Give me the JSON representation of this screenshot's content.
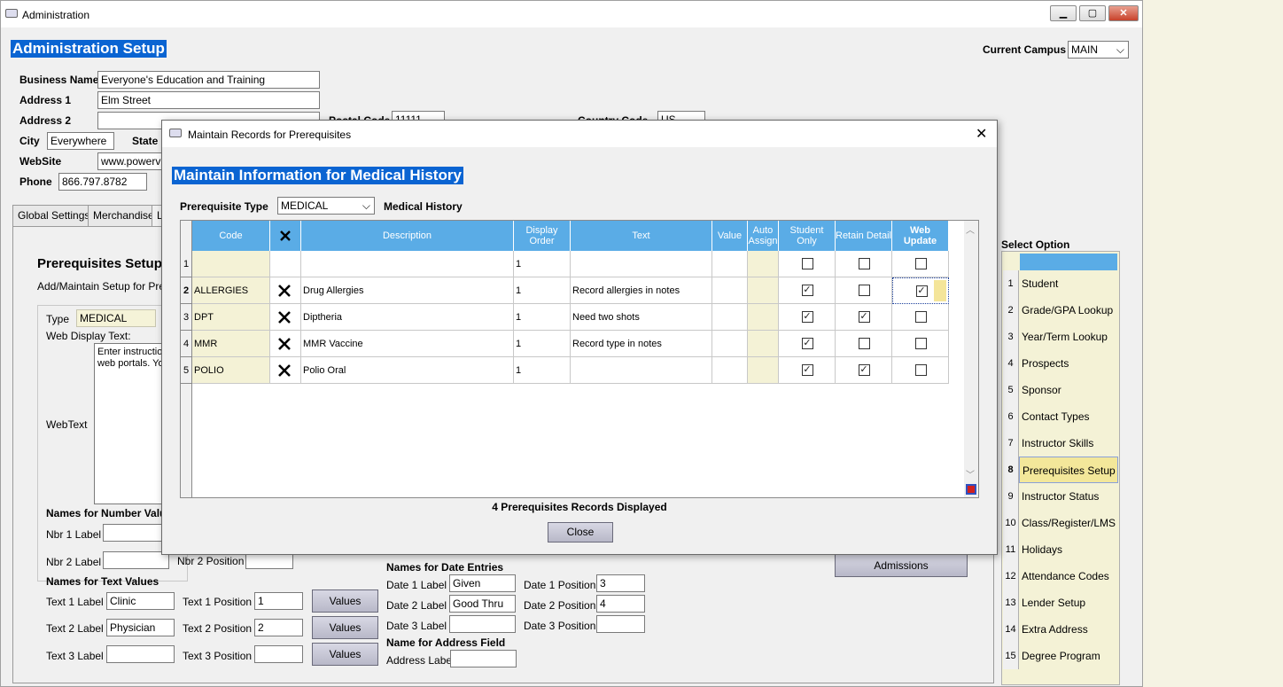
{
  "window": {
    "title": "Administration"
  },
  "header": {
    "title": "Administration Setup",
    "campus_label": "Current Campus",
    "campus_value": "MAIN"
  },
  "business": {
    "name_label": "Business Name",
    "name_value": "Everyone's Education and Training",
    "address1_label": "Address 1",
    "address1_value": "Elm Street",
    "address2_label": "Address 2",
    "address2_value": "",
    "postal_label": "Postal Code",
    "postal_value": "11111",
    "country_label": "Country Code",
    "country_value": "US",
    "city_label": "City",
    "city_value": "Everywhere",
    "state_label": "State",
    "website_label": "WebSite",
    "website_value": "www.powervis",
    "phone_label": "Phone",
    "phone_value": "866.797.8782"
  },
  "tabs": [
    "Global Settings",
    "Merchandise",
    "L"
  ],
  "prereq_panel": {
    "title": "Prerequisites Setup",
    "subtitle": "Add/Maintain Setup for Prerec",
    "type_label": "Type",
    "type_value": "MEDICAL",
    "web_display_label": "Web Display Text:",
    "webtext_label": "WebText",
    "webtext_value": "Enter instructio\nweb portals. Yo",
    "numbers_heading": "Names for Number Valu",
    "nbr1_label": "Nbr 1 Label",
    "nbr2_label": "Nbr 2 Label",
    "nbr2_position_label": "Nbr 2 Position",
    "text_heading": "Names for Text Values",
    "text_rows": [
      {
        "label": "Text 1 Label",
        "value": "Clinic",
        "pos_label": "Text 1 Position",
        "pos_value": "1",
        "button": "Values"
      },
      {
        "label": "Text 2 Label",
        "value": "Physician",
        "pos_label": "Text 2 Position",
        "pos_value": "2",
        "button": "Values"
      },
      {
        "label": "Text 3 Label",
        "value": "",
        "pos_label": "Text 3 Position",
        "pos_value": "",
        "button": "Values"
      }
    ],
    "date_heading": "Names for Date Entries",
    "date_rows": [
      {
        "label": "Date 1 Label",
        "value": "Given",
        "pos_label": "Date 1 Position",
        "pos_value": "3"
      },
      {
        "label": "Date 2 Label",
        "value": "Good Thru",
        "pos_label": "Date 2 Position",
        "pos_value": "4"
      },
      {
        "label": "Date 3 Label",
        "value": "",
        "pos_label": "Date 3 Position",
        "pos_value": ""
      }
    ],
    "address_heading": "Name for Address Field",
    "address_label": "Address Label",
    "admissions_button": "Admissions"
  },
  "sidebar": {
    "title": "Select Option",
    "items": [
      {
        "num": "1",
        "label": "Student"
      },
      {
        "num": "2",
        "label": "Grade/GPA Lookup"
      },
      {
        "num": "3",
        "label": "Year/Term Lookup"
      },
      {
        "num": "4",
        "label": "Prospects"
      },
      {
        "num": "5",
        "label": "Sponsor"
      },
      {
        "num": "6",
        "label": "Contact Types"
      },
      {
        "num": "7",
        "label": "Instructor Skills"
      },
      {
        "num": "8",
        "label": "Prerequisites Setup"
      },
      {
        "num": "9",
        "label": "Instructor Status"
      },
      {
        "num": "10",
        "label": "Class/Register/LMS"
      },
      {
        "num": "11",
        "label": "Holidays"
      },
      {
        "num": "12",
        "label": "Attendance Codes"
      },
      {
        "num": "13",
        "label": "Lender Setup"
      },
      {
        "num": "14",
        "label": "Extra Address Setup"
      },
      {
        "num": "15",
        "label": "Degree Program"
      }
    ],
    "selected": "8"
  },
  "dialog": {
    "title": "Maintain Records for Prerequisites",
    "heading": "Maintain Information for Medical History",
    "prereq_type_label": "Prerequisite Type",
    "prereq_type_value": "MEDICAL",
    "prereq_type_desc": "Medical History",
    "columns": [
      "Code",
      "",
      "Description",
      "Display Order",
      "Text",
      "Value",
      "Auto Assign",
      "Student Only",
      "Retain Detail",
      "Web Update"
    ],
    "rows": [
      {
        "num": "1",
        "code": "",
        "delete": false,
        "description": "",
        "order": "1",
        "text": "",
        "value": "",
        "student_only": false,
        "retain": false,
        "web": false
      },
      {
        "num": "2",
        "code": "ALLERGIES",
        "delete": true,
        "description": "Drug Allergies",
        "order": "1",
        "text": "Record allergies in notes",
        "value": "",
        "student_only": true,
        "retain": false,
        "web": true
      },
      {
        "num": "3",
        "code": "DPT",
        "delete": true,
        "description": "Diptheria",
        "order": "1",
        "text": "Need two shots",
        "value": "",
        "student_only": true,
        "retain": true,
        "web": false
      },
      {
        "num": "4",
        "code": "MMR",
        "delete": true,
        "description": "MMR Vaccine",
        "order": "1",
        "text": "Record type in notes",
        "value": "",
        "student_only": true,
        "retain": false,
        "web": false
      },
      {
        "num": "5",
        "code": "POLIO",
        "delete": true,
        "description": "Polio Oral",
        "order": "1",
        "text": "",
        "value": "",
        "student_only": true,
        "retain": true,
        "web": false
      }
    ],
    "status": "4 Prerequisites Records Displayed",
    "close_button": "Close"
  }
}
